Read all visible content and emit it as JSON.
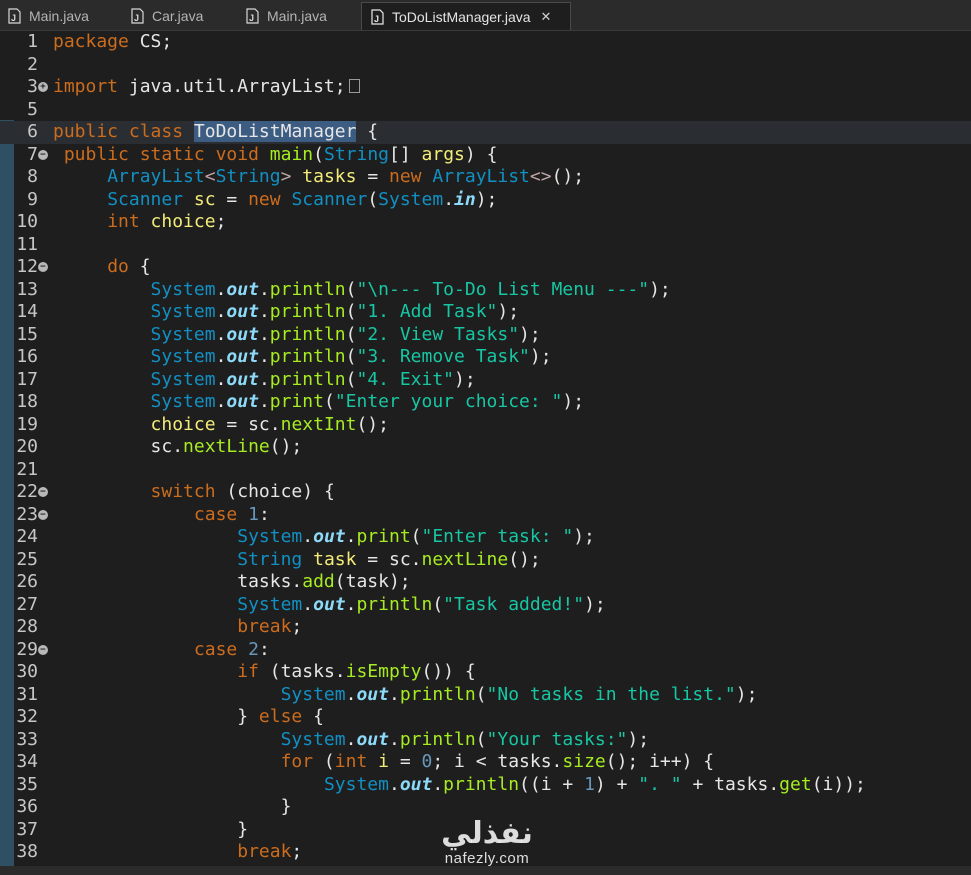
{
  "tabs": [
    {
      "label": "Main.java",
      "active": false
    },
    {
      "label": "Car.java",
      "active": false
    },
    {
      "label": "Main.java",
      "active": false
    },
    {
      "label": "ToDoListManager.java",
      "active": true
    }
  ],
  "tab_close_glyph": "✕",
  "watermark": {
    "arabic": "نفذلي",
    "latin": "nafezly.com"
  },
  "colors": {
    "keyword": "#cc6c1d",
    "type": "#1290c3",
    "variable": "#f3ec79",
    "method": "#a7ec21",
    "string": "#17c6a3",
    "number": "#6897bb",
    "static_field": "#8dd9f8",
    "plain": "#e6e6e6",
    "selection": "#3c5c82"
  },
  "code_lines": [
    {
      "n": "1",
      "fold": false,
      "tokens": [
        [
          "kw",
          "package"
        ],
        [
          "pl",
          " CS;"
        ]
      ]
    },
    {
      "n": "2",
      "fold": false,
      "tokens": []
    },
    {
      "n": "3",
      "fold": "plus",
      "tokens": [
        [
          "kw",
          "import"
        ],
        [
          "pl",
          " java.util.ArrayList;"
        ]
      ],
      "folded": true
    },
    {
      "n": "5",
      "fold": false,
      "tokens": []
    },
    {
      "n": "6",
      "fold": false,
      "current": true,
      "tokens": [
        [
          "kw",
          "public"
        ],
        [
          "pl",
          " "
        ],
        [
          "kw",
          "class"
        ],
        [
          "pl",
          " "
        ],
        [
          "sel",
          "ToDoListManager"
        ],
        [
          "pl",
          " {"
        ]
      ]
    },
    {
      "n": "7",
      "fold": "minus",
      "tokens": [
        [
          "pl",
          " "
        ],
        [
          "kw",
          "public"
        ],
        [
          "pl",
          " "
        ],
        [
          "kw",
          "static"
        ],
        [
          "pl",
          " "
        ],
        [
          "kw",
          "void"
        ],
        [
          "pl",
          " "
        ],
        [
          "fn",
          "main"
        ],
        [
          "pl",
          "("
        ],
        [
          "ty",
          "String"
        ],
        [
          "pl",
          "[] "
        ],
        [
          "vr",
          "args"
        ],
        [
          "pl",
          ") {"
        ]
      ]
    },
    {
      "n": "8",
      "fold": false,
      "tokens": [
        [
          "pl",
          "     "
        ],
        [
          "ty",
          "ArrayList"
        ],
        [
          "gt",
          "<"
        ],
        [
          "ty",
          "String"
        ],
        [
          "gt",
          ">"
        ],
        [
          "pl",
          " "
        ],
        [
          "vr",
          "tasks"
        ],
        [
          "pl",
          " = "
        ],
        [
          "kw",
          "new"
        ],
        [
          "pl",
          " "
        ],
        [
          "ty",
          "ArrayList"
        ],
        [
          "gt",
          "<>"
        ],
        [
          "pl",
          "();"
        ]
      ]
    },
    {
      "n": "9",
      "fold": false,
      "tokens": [
        [
          "pl",
          "     "
        ],
        [
          "ty",
          "Scanner"
        ],
        [
          "pl",
          " "
        ],
        [
          "vr",
          "sc"
        ],
        [
          "pl",
          " = "
        ],
        [
          "kw",
          "new"
        ],
        [
          "pl",
          " "
        ],
        [
          "ty",
          "Scanner"
        ],
        [
          "pl",
          "("
        ],
        [
          "ty",
          "System"
        ],
        [
          "pl",
          "."
        ],
        [
          "sf",
          "in"
        ],
        [
          "pl",
          ");"
        ]
      ]
    },
    {
      "n": "10",
      "fold": false,
      "tokens": [
        [
          "pl",
          "     "
        ],
        [
          "kw",
          "int"
        ],
        [
          "pl",
          " "
        ],
        [
          "vr",
          "choice"
        ],
        [
          "pl",
          ";"
        ]
      ]
    },
    {
      "n": "11",
      "fold": false,
      "tokens": []
    },
    {
      "n": "12",
      "fold": "minus",
      "tokens": [
        [
          "pl",
          "     "
        ],
        [
          "kw",
          "do"
        ],
        [
          "pl",
          " {"
        ]
      ]
    },
    {
      "n": "13",
      "fold": false,
      "tokens": [
        [
          "pl",
          "         "
        ],
        [
          "ty",
          "System"
        ],
        [
          "pl",
          "."
        ],
        [
          "sf",
          "out"
        ],
        [
          "pl",
          "."
        ],
        [
          "fn",
          "println"
        ],
        [
          "pl",
          "("
        ],
        [
          "st",
          "\"\\n--- To-Do List Menu ---\""
        ],
        [
          "pl",
          ");"
        ]
      ]
    },
    {
      "n": "14",
      "fold": false,
      "tokens": [
        [
          "pl",
          "         "
        ],
        [
          "ty",
          "System"
        ],
        [
          "pl",
          "."
        ],
        [
          "sf",
          "out"
        ],
        [
          "pl",
          "."
        ],
        [
          "fn",
          "println"
        ],
        [
          "pl",
          "("
        ],
        [
          "st",
          "\"1. Add Task\""
        ],
        [
          "pl",
          ");"
        ]
      ]
    },
    {
      "n": "15",
      "fold": false,
      "tokens": [
        [
          "pl",
          "         "
        ],
        [
          "ty",
          "System"
        ],
        [
          "pl",
          "."
        ],
        [
          "sf",
          "out"
        ],
        [
          "pl",
          "."
        ],
        [
          "fn",
          "println"
        ],
        [
          "pl",
          "("
        ],
        [
          "st",
          "\"2. View Tasks\""
        ],
        [
          "pl",
          ");"
        ]
      ]
    },
    {
      "n": "16",
      "fold": false,
      "tokens": [
        [
          "pl",
          "         "
        ],
        [
          "ty",
          "System"
        ],
        [
          "pl",
          "."
        ],
        [
          "sf",
          "out"
        ],
        [
          "pl",
          "."
        ],
        [
          "fn",
          "println"
        ],
        [
          "pl",
          "("
        ],
        [
          "st",
          "\"3. Remove Task\""
        ],
        [
          "pl",
          ");"
        ]
      ]
    },
    {
      "n": "17",
      "fold": false,
      "tokens": [
        [
          "pl",
          "         "
        ],
        [
          "ty",
          "System"
        ],
        [
          "pl",
          "."
        ],
        [
          "sf",
          "out"
        ],
        [
          "pl",
          "."
        ],
        [
          "fn",
          "println"
        ],
        [
          "pl",
          "("
        ],
        [
          "st",
          "\"4. Exit\""
        ],
        [
          "pl",
          ");"
        ]
      ]
    },
    {
      "n": "18",
      "fold": false,
      "tokens": [
        [
          "pl",
          "         "
        ],
        [
          "ty",
          "System"
        ],
        [
          "pl",
          "."
        ],
        [
          "sf",
          "out"
        ],
        [
          "pl",
          "."
        ],
        [
          "fn",
          "print"
        ],
        [
          "pl",
          "("
        ],
        [
          "st",
          "\"Enter your choice: \""
        ],
        [
          "pl",
          ");"
        ]
      ]
    },
    {
      "n": "19",
      "fold": false,
      "tokens": [
        [
          "pl",
          "         "
        ],
        [
          "vr",
          "choice"
        ],
        [
          "pl",
          " = sc."
        ],
        [
          "fn",
          "nextInt"
        ],
        [
          "pl",
          "();"
        ]
      ]
    },
    {
      "n": "20",
      "fold": false,
      "tokens": [
        [
          "pl",
          "         sc."
        ],
        [
          "fn",
          "nextLine"
        ],
        [
          "pl",
          "();"
        ]
      ]
    },
    {
      "n": "21",
      "fold": false,
      "tokens": []
    },
    {
      "n": "22",
      "fold": "minus",
      "tokens": [
        [
          "pl",
          "         "
        ],
        [
          "kw",
          "switch"
        ],
        [
          "pl",
          " (choice) {"
        ]
      ]
    },
    {
      "n": "23",
      "fold": "minus",
      "tokens": [
        [
          "pl",
          "             "
        ],
        [
          "kw",
          "case"
        ],
        [
          "pl",
          " "
        ],
        [
          "nu",
          "1"
        ],
        [
          "pl",
          ":"
        ]
      ]
    },
    {
      "n": "24",
      "fold": false,
      "tokens": [
        [
          "pl",
          "                 "
        ],
        [
          "ty",
          "System"
        ],
        [
          "pl",
          "."
        ],
        [
          "sf",
          "out"
        ],
        [
          "pl",
          "."
        ],
        [
          "fn",
          "print"
        ],
        [
          "pl",
          "("
        ],
        [
          "st",
          "\"Enter task: \""
        ],
        [
          "pl",
          ");"
        ]
      ]
    },
    {
      "n": "25",
      "fold": false,
      "tokens": [
        [
          "pl",
          "                 "
        ],
        [
          "ty",
          "String"
        ],
        [
          "pl",
          " "
        ],
        [
          "vr",
          "task"
        ],
        [
          "pl",
          " = sc."
        ],
        [
          "fn",
          "nextLine"
        ],
        [
          "pl",
          "();"
        ]
      ]
    },
    {
      "n": "26",
      "fold": false,
      "tokens": [
        [
          "pl",
          "                 tasks."
        ],
        [
          "fn",
          "add"
        ],
        [
          "pl",
          "(task);"
        ]
      ]
    },
    {
      "n": "27",
      "fold": false,
      "tokens": [
        [
          "pl",
          "                 "
        ],
        [
          "ty",
          "System"
        ],
        [
          "pl",
          "."
        ],
        [
          "sf",
          "out"
        ],
        [
          "pl",
          "."
        ],
        [
          "fn",
          "println"
        ],
        [
          "pl",
          "("
        ],
        [
          "st",
          "\"Task added!\""
        ],
        [
          "pl",
          ");"
        ]
      ]
    },
    {
      "n": "28",
      "fold": false,
      "tokens": [
        [
          "pl",
          "                 "
        ],
        [
          "kw",
          "break"
        ],
        [
          "pl",
          ";"
        ]
      ]
    },
    {
      "n": "29",
      "fold": "minus",
      "tokens": [
        [
          "pl",
          "             "
        ],
        [
          "kw",
          "case"
        ],
        [
          "pl",
          " "
        ],
        [
          "nu",
          "2"
        ],
        [
          "pl",
          ":"
        ]
      ]
    },
    {
      "n": "30",
      "fold": false,
      "tokens": [
        [
          "pl",
          "                 "
        ],
        [
          "kw",
          "if"
        ],
        [
          "pl",
          " (tasks."
        ],
        [
          "fn",
          "isEmpty"
        ],
        [
          "pl",
          "()) {"
        ]
      ]
    },
    {
      "n": "31",
      "fold": false,
      "tokens": [
        [
          "pl",
          "                     "
        ],
        [
          "ty",
          "System"
        ],
        [
          "pl",
          "."
        ],
        [
          "sf",
          "out"
        ],
        [
          "pl",
          "."
        ],
        [
          "fn",
          "println"
        ],
        [
          "pl",
          "("
        ],
        [
          "st",
          "\"No tasks in the list.\""
        ],
        [
          "pl",
          ");"
        ]
      ]
    },
    {
      "n": "32",
      "fold": false,
      "tokens": [
        [
          "pl",
          "                 } "
        ],
        [
          "kw",
          "else"
        ],
        [
          "pl",
          " {"
        ]
      ]
    },
    {
      "n": "33",
      "fold": false,
      "tokens": [
        [
          "pl",
          "                     "
        ],
        [
          "ty",
          "System"
        ],
        [
          "pl",
          "."
        ],
        [
          "sf",
          "out"
        ],
        [
          "pl",
          "."
        ],
        [
          "fn",
          "println"
        ],
        [
          "pl",
          "("
        ],
        [
          "st",
          "\"Your tasks:\""
        ],
        [
          "pl",
          ");"
        ]
      ]
    },
    {
      "n": "34",
      "fold": false,
      "tokens": [
        [
          "pl",
          "                     "
        ],
        [
          "kw",
          "for"
        ],
        [
          "pl",
          " ("
        ],
        [
          "kw",
          "int"
        ],
        [
          "pl",
          " "
        ],
        [
          "vr",
          "i"
        ],
        [
          "pl",
          " = "
        ],
        [
          "nu",
          "0"
        ],
        [
          "pl",
          "; i < tasks."
        ],
        [
          "fn",
          "size"
        ],
        [
          "pl",
          "(); i++) {"
        ]
      ]
    },
    {
      "n": "35",
      "fold": false,
      "tokens": [
        [
          "pl",
          "                         "
        ],
        [
          "ty",
          "System"
        ],
        [
          "pl",
          "."
        ],
        [
          "sf",
          "out"
        ],
        [
          "pl",
          "."
        ],
        [
          "fn",
          "println"
        ],
        [
          "pl",
          "((i + "
        ],
        [
          "nu",
          "1"
        ],
        [
          "pl",
          ") + "
        ],
        [
          "st",
          "\". \""
        ],
        [
          "pl",
          " + tasks."
        ],
        [
          "fn",
          "get"
        ],
        [
          "pl",
          "(i));"
        ]
      ]
    },
    {
      "n": "36",
      "fold": false,
      "tokens": [
        [
          "pl",
          "                     }"
        ]
      ]
    },
    {
      "n": "37",
      "fold": false,
      "tokens": [
        [
          "pl",
          "                 }"
        ]
      ]
    },
    {
      "n": "38",
      "fold": false,
      "tokens": [
        [
          "pl",
          "                 "
        ],
        [
          "kw",
          "break"
        ],
        [
          "pl",
          ";"
        ]
      ]
    }
  ]
}
